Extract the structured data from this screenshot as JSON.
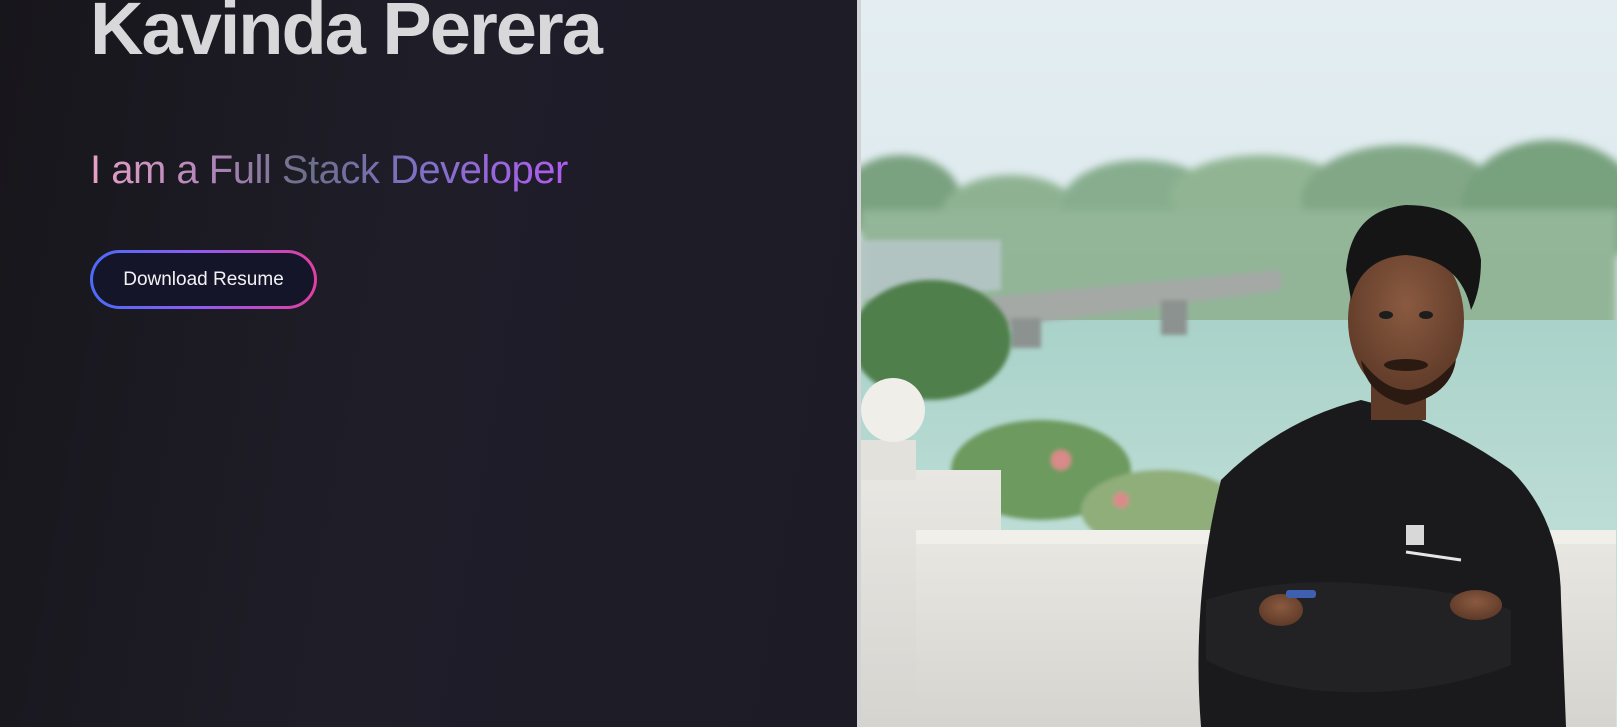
{
  "hero": {
    "name": "Kavinda Perera",
    "tagline": "I am a Full Stack Developer",
    "resume_button_label": "Download Resume"
  },
  "profile_photo": {
    "icon": "portrait-photo"
  },
  "colors": {
    "background": "#1b1a22",
    "name_text": "#d8d8da",
    "tagline_gradient_start": "#e8a0c8",
    "tagline_gradient_end": "#b05cf0",
    "button_border_start": "#4a6cf7",
    "button_border_end": "#e040a0",
    "button_fill": "#15152a"
  }
}
